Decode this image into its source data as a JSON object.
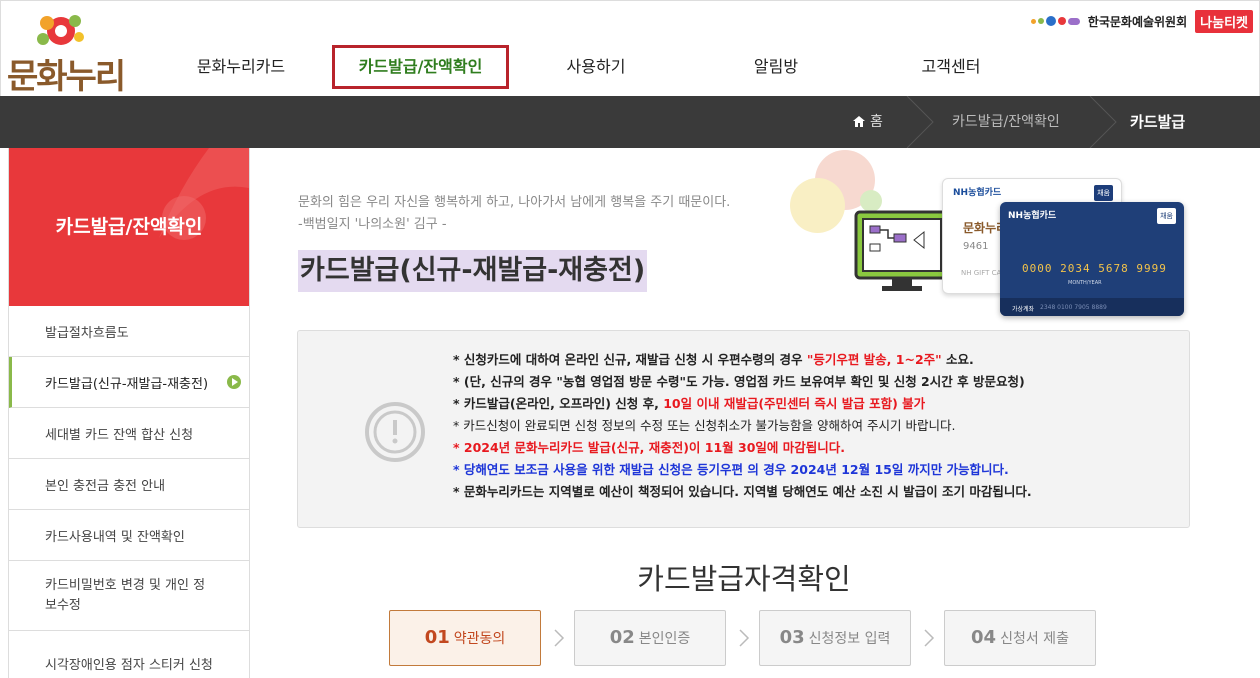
{
  "header": {
    "logo_text": "문화누리",
    "nav": [
      "문화누리카드",
      "카드발급/잔액확인",
      "사용하기",
      "알림방",
      "고객센터"
    ],
    "active_nav": "카드발급/잔액확인",
    "org_name": "한국문화예술위원회",
    "ticket_brand": "나눔티켓"
  },
  "breadcrumb": {
    "home": "홈",
    "level1": "카드발급/잔액확인",
    "current": "카드발급"
  },
  "sidebar": {
    "title": "카드발급/잔액확인",
    "items": [
      {
        "label": "발급절차흐름도"
      },
      {
        "label": "카드발급(신규-재발급-재충전)"
      },
      {
        "label": "세대별 카드 잔액 합산 신청"
      },
      {
        "label": "본인 충전금 충전 안내"
      },
      {
        "label": "카드사용내역 및 잔액확인"
      },
      {
        "label": "카드비밀번호 변경 및 개인 정보수정"
      },
      {
        "label": "시각장애인용 점자 스티커 신청"
      }
    ],
    "active_index": 1
  },
  "main": {
    "quote_line1": "문화의 힘은 우리 자신을 행복하게 하고, 나아가서 남에게 행복을 주기 때문이다.",
    "quote_line2": "-백범일지 '나의소원' 김구 -",
    "page_title": "카드발급(신규-재발급-재충전)",
    "card_visual": {
      "card1_brand": "NH농협카드",
      "card1_tag": "채움",
      "card1_logo": "문화누리",
      "card1_digits": "9461",
      "card1_caption": "NH GIFT CA",
      "card2_brand": "NH농협카드",
      "card2_tag": "채움",
      "card2_number": "0000 2034 5678 9999",
      "card2_month_year": "MONTH/YEAR",
      "card2_account_label": "가상계좌",
      "card2_account": "2348 0100 7905 8889"
    },
    "notice": {
      "l1_a": "* 신청카드에 대하여 온라인 신규, 재발급 신청 시 우편수령의 경우 ",
      "l1_b": "\"등기우편 발송, 1~2주\"",
      "l1_c": " 소요.",
      "l2": "* (단, 신규의 경우 \"농협 영업점 방문 수령\"도 가능. 영업점 카드 보유여부 확인 및 신청 2시간 후 방문요청)",
      "l3_a": "* 카드발급(온라인, 오프라인) 신청 후, ",
      "l3_b": "10일 이내 재발급(주민센터 즉시 발급 포함) 불가",
      "l4": "* 카드신청이 완료되면 신청 정보의 수정 또는 신청취소가 불가능함을 양해하여 주시기 바랍니다.",
      "l5": "* 2024년 문화누리카드 발급(신규, 재충전)이 11월 30일에 마감됩니다.",
      "l6": "* 당해연도 보조금 사용을 위한 재발급 신청은 등기우편 의 경우 2024년 12월 15일 까지만 가능합니다.",
      "l7": "* 문화누리카드는 지역별로 예산이 책정되어 있습니다. 지역별 당해연도 예산 소진 시 발급이 조기 마감됩니다."
    },
    "section_title": "카드발급자격확인",
    "steps": [
      {
        "num": "01",
        "label": "약관동의"
      },
      {
        "num": "02",
        "label": "본인인증"
      },
      {
        "num": "03",
        "label": "신청정보 입력"
      },
      {
        "num": "04",
        "label": "신청서 제출"
      }
    ],
    "active_step": 0
  },
  "colors": {
    "accent_red": "#e8383b",
    "nav_active_border": "#b8232b",
    "nav_active_text": "#2f7d1e",
    "breadcrumb_bg": "#3a3a3a",
    "highlight_bg": "#e4daf0",
    "notice_red": "#e8191f",
    "notice_blue": "#1e36d8"
  }
}
